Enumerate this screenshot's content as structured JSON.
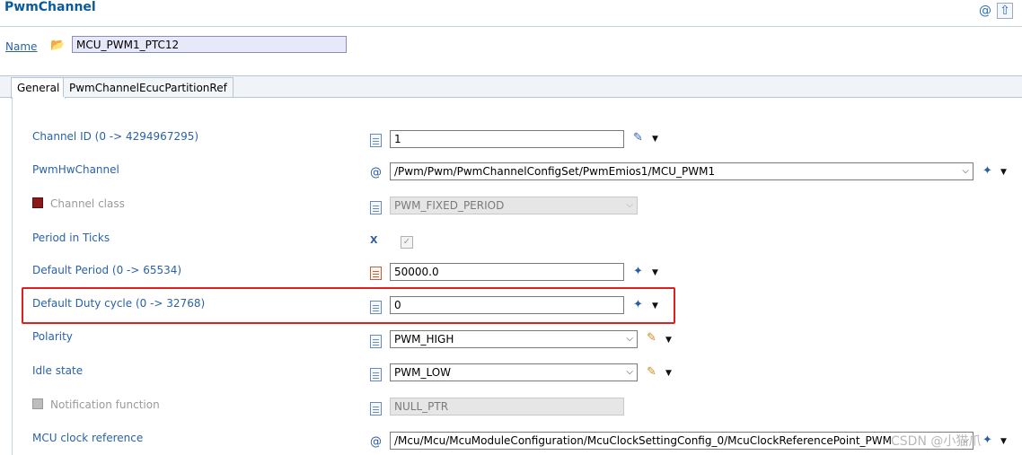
{
  "header": {
    "title": "PwmChannel",
    "icons": [
      "at-icon",
      "up-arrow-icon",
      "more-icon"
    ]
  },
  "name_field": {
    "label": "Name",
    "value": "MCU_PWM1_PTC12"
  },
  "tabs": [
    {
      "label": "General",
      "active": true
    },
    {
      "label": "PwmChannelEcucPartitionRef",
      "active": false
    }
  ],
  "params": {
    "channel_id": {
      "label": "Channel ID (0 -> 4294967295)",
      "value": "1"
    },
    "hw_channel": {
      "label": "PwmHwChannel",
      "value": "/Pwm/Pwm/PwmChannelConfigSet/PwmEmios1/MCU_PWM1"
    },
    "channel_class": {
      "label": "Channel class",
      "value": "PWM_FIXED_PERIOD"
    },
    "period_in_ticks": {
      "label": "Period in Ticks",
      "checked": true
    },
    "default_period": {
      "label": "Default Period (0 -> 65534)",
      "value": "50000.0"
    },
    "default_duty": {
      "label": "Default Duty cycle (0 -> 32768)",
      "value": "0"
    },
    "polarity": {
      "label": "Polarity",
      "value": "PWM_HIGH"
    },
    "idle_state": {
      "label": "Idle state",
      "value": "PWM_LOW"
    },
    "notification": {
      "label": "Notification function",
      "value": "NULL_PTR"
    },
    "mcu_clock": {
      "label": "MCU clock reference",
      "value": "/Mcu/Mcu/McuModuleConfiguration/McuClockSettingConfig_0/McuClockReferencePoint_PWM"
    }
  },
  "watermark": "CSDN @小猫爪",
  "colors": {
    "label_blue": "#2a62a8",
    "highlight_red": "#e02020",
    "title_blue": "#0a5a9c"
  }
}
